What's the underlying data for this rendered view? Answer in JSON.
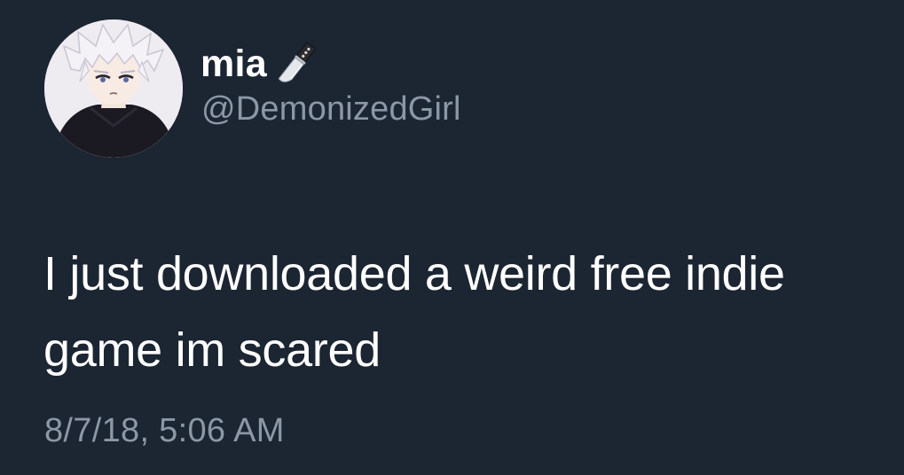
{
  "tweet": {
    "author": {
      "display_name": "mia",
      "name_emoji_icon": "kitchen-knife-icon",
      "handle": "@DemonizedGirl",
      "avatar_icon": "anime-avatar"
    },
    "text_line1": "I just downloaded a weird free indie",
    "text_line2": "game im scared",
    "timestamp": "8/7/18, 5:06 AM"
  },
  "colors": {
    "background": "#1c2532",
    "primary_text": "#ffffff",
    "secondary_text": "#8b98a5"
  }
}
